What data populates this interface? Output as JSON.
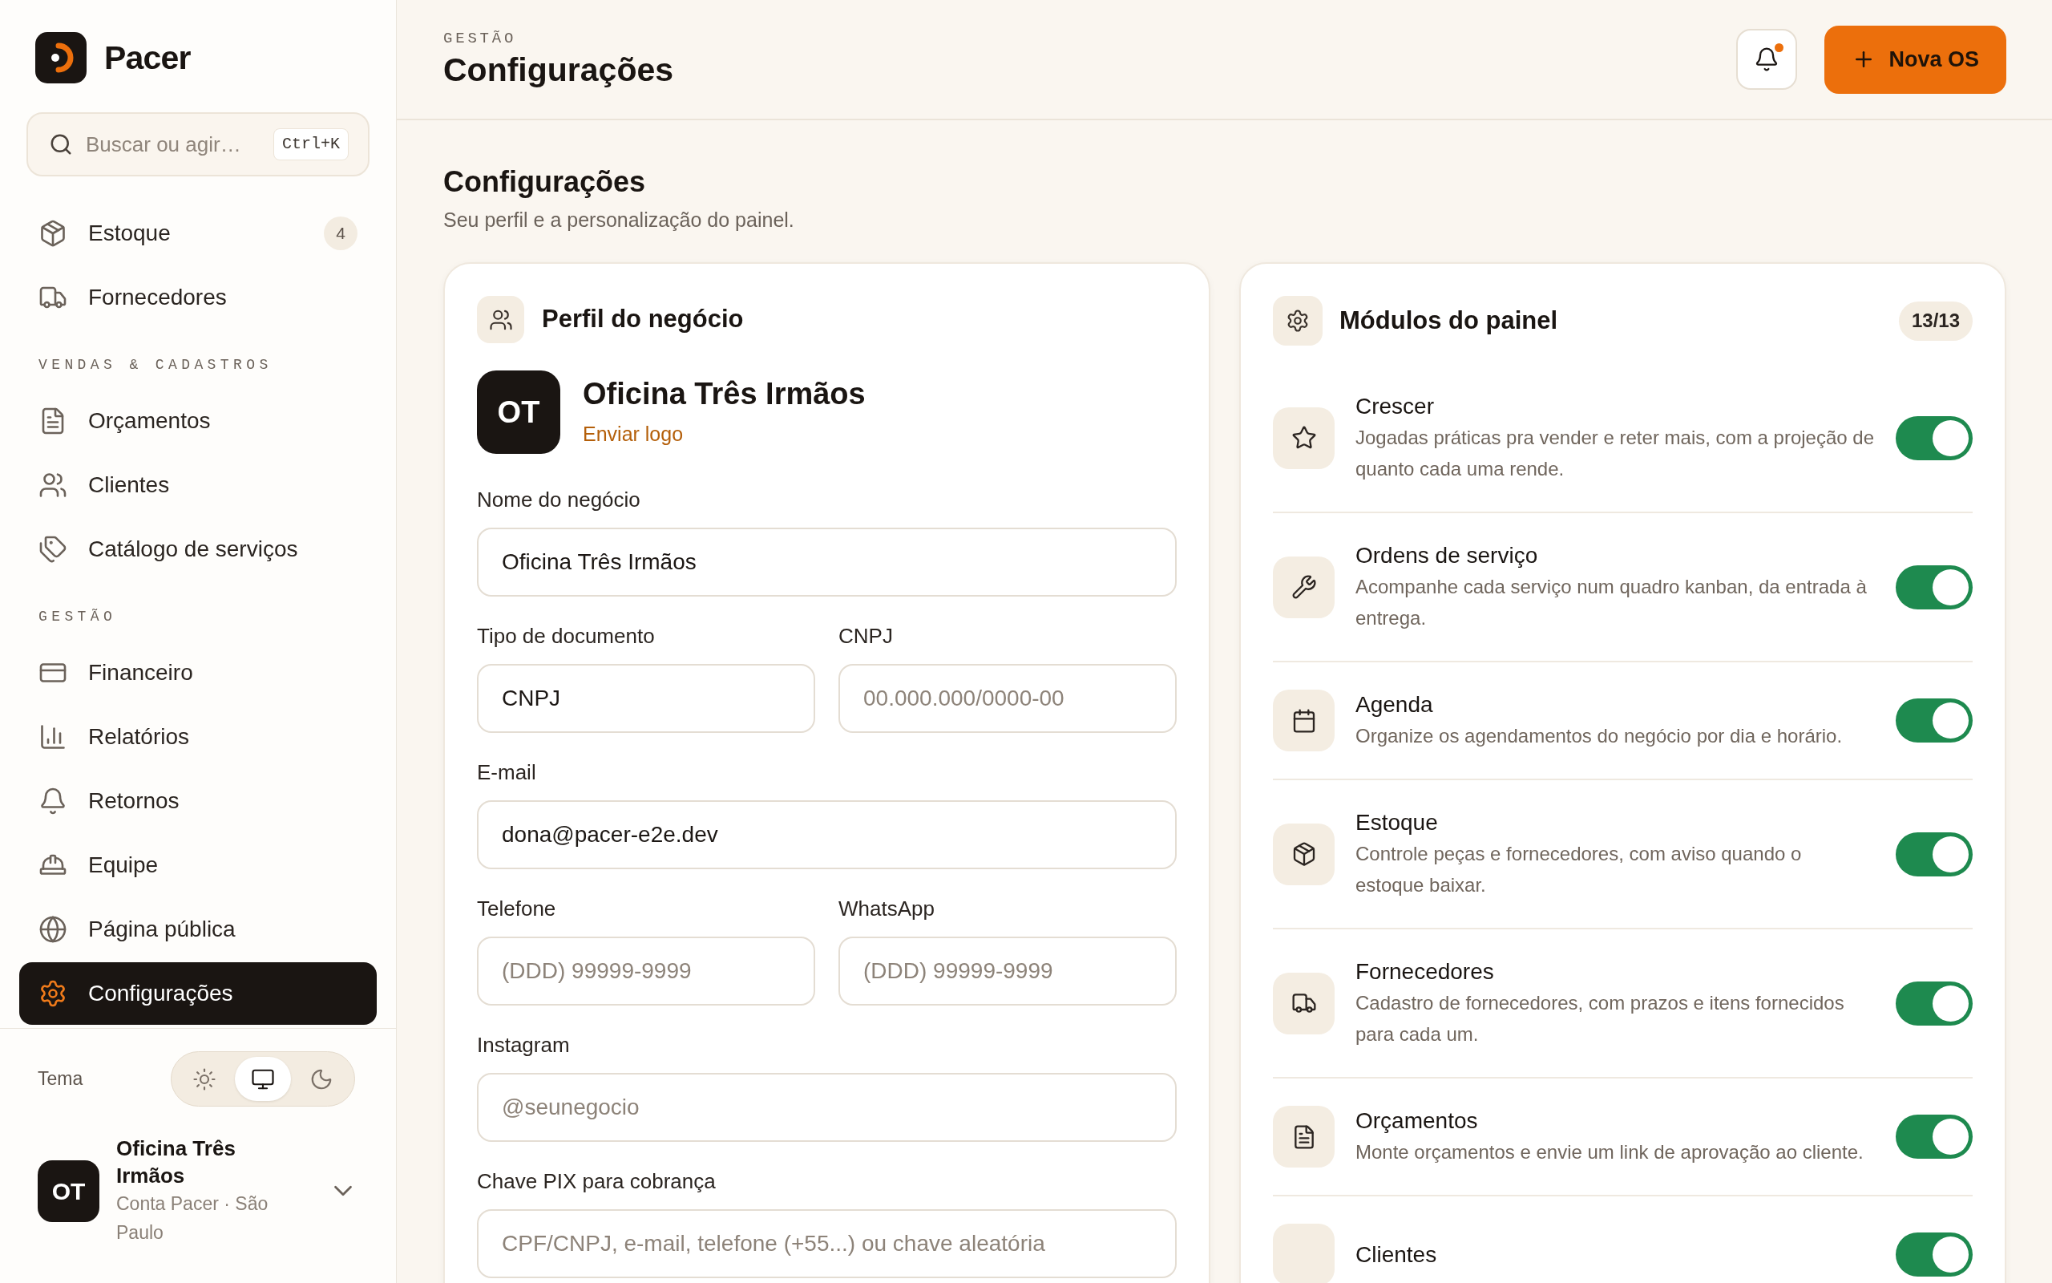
{
  "sidebar": {
    "brand": "Pacer",
    "search": {
      "placeholder": "Buscar ou agir…",
      "shortcut": "Ctrl+K"
    },
    "nav_groups": [
      {
        "items": [
          {
            "label": "Estoque",
            "badge": "4",
            "selected": false
          },
          {
            "label": "Fornecedores",
            "selected": false
          }
        ]
      },
      {
        "heading": "VENDAS & CADASTROS",
        "items": [
          {
            "label": "Orçamentos",
            "selected": false
          },
          {
            "label": "Clientes",
            "selected": false
          },
          {
            "label": "Catálogo de serviços",
            "selected": false
          }
        ]
      },
      {
        "heading": "GESTÃO",
        "items": [
          {
            "label": "Financeiro",
            "selected": false
          },
          {
            "label": "Relatórios",
            "selected": false
          },
          {
            "label": "Retornos",
            "selected": false
          },
          {
            "label": "Equipe",
            "selected": false
          },
          {
            "label": "Página pública",
            "selected": false
          },
          {
            "label": "Configurações",
            "selected": true
          }
        ]
      }
    ],
    "theme": {
      "label": "Tema",
      "options": [
        {
          "kind": "light",
          "selected": false
        },
        {
          "kind": "system",
          "selected": true
        },
        {
          "kind": "dark",
          "selected": false
        }
      ]
    },
    "account": {
      "initials": "OT",
      "name": "Oficina Três Irmãos",
      "subtitle": "Conta Pacer · São Paulo"
    }
  },
  "header": {
    "eyebrow": "GESTÃO",
    "title": "Configurações",
    "notifications": {
      "unread": true
    },
    "primary_button": "Nova OS"
  },
  "page": {
    "title": "Configurações",
    "subtitle": "Seu perfil e a personalização do painel."
  },
  "profile_card": {
    "title": "Perfil do negócio",
    "initials": "OT",
    "business_name": "Oficina Três Irmãos",
    "upload_link": "Enviar logo",
    "field_rows": [
      [
        {
          "label": "Nome do negócio",
          "value": "Oficina Três Irmãos"
        }
      ],
      [
        {
          "label": "Tipo de documento",
          "value": "CNPJ"
        },
        {
          "label": "CNPJ",
          "placeholder": "00.000.000/0000-00"
        }
      ],
      [
        {
          "label": "E-mail",
          "value": "dona@pacer-e2e.dev"
        }
      ],
      [
        {
          "label": "Telefone",
          "placeholder": "(DDD) 99999-9999"
        },
        {
          "label": "WhatsApp",
          "placeholder": "(DDD) 99999-9999"
        }
      ],
      [
        {
          "label": "Instagram",
          "placeholder": "@seunegocio"
        }
      ],
      [
        {
          "label": "Chave PIX para cobrança",
          "placeholder": "CPF/CNPJ, e-mail, telefone (+55...) ou chave aleatória"
        }
      ]
    ]
  },
  "modules_card": {
    "title": "Módulos do painel",
    "count": "13/13",
    "modules": [
      {
        "name": "Crescer",
        "description": "Jogadas práticas pra vender e reter mais, com a projeção de quanto cada uma rende.",
        "on": true
      },
      {
        "name": "Ordens de serviço",
        "description": "Acompanhe cada serviço num quadro kanban, da entrada à entrega.",
        "on": true
      },
      {
        "name": "Agenda",
        "description": "Organize os agendamentos do negócio por dia e horário.",
        "on": true
      },
      {
        "name": "Estoque",
        "description": "Controle peças e fornecedores, com aviso quando o estoque baixar.",
        "on": true
      },
      {
        "name": "Fornecedores",
        "description": "Cadastro de fornecedores, com prazos e itens fornecidos para cada um.",
        "on": true
      },
      {
        "name": "Orçamentos",
        "description": "Monte orçamentos e envie um link de aprovação ao cliente.",
        "on": true
      },
      {
        "name": "Clientes",
        "on": true
      }
    ]
  }
}
